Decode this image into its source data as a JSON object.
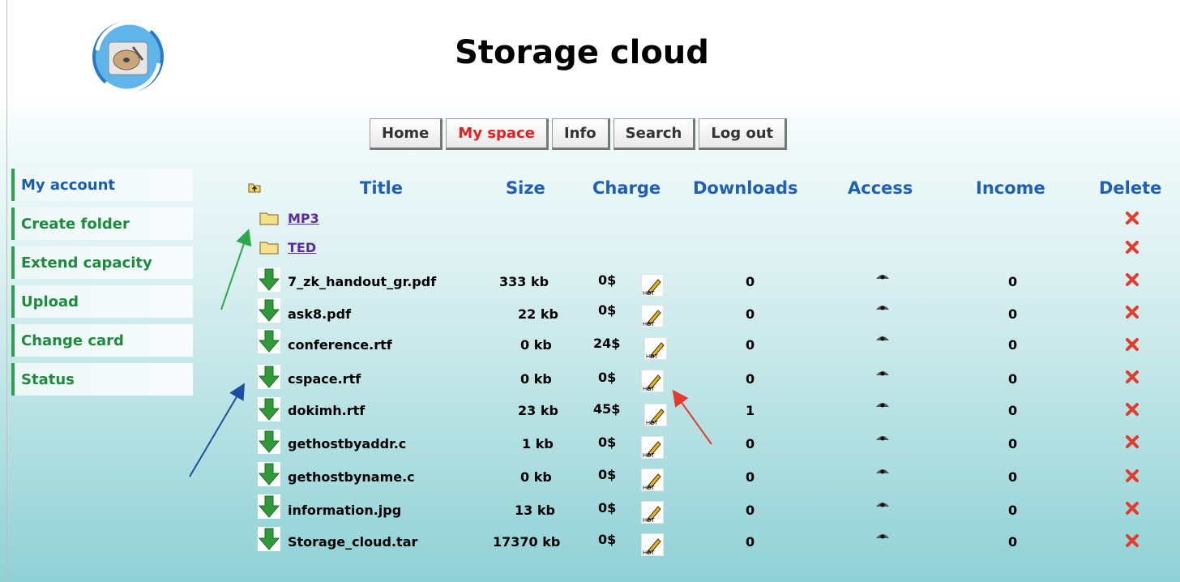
{
  "site": {
    "title": "Storage cloud"
  },
  "tabs": [
    {
      "label": "Home",
      "active": false
    },
    {
      "label": "My space",
      "active": true
    },
    {
      "label": "Info",
      "active": false
    },
    {
      "label": "Search",
      "active": false
    },
    {
      "label": "Log out",
      "active": false
    }
  ],
  "sidebar": {
    "items": [
      {
        "label": "My account"
      },
      {
        "label": "Create folder"
      },
      {
        "label": "Extend capacity"
      },
      {
        "label": "Upload"
      },
      {
        "label": "Change card"
      },
      {
        "label": "Status"
      }
    ]
  },
  "table": {
    "headers": {
      "title": "Title",
      "size": "Size",
      "charge": "Charge",
      "downloads": "Downloads",
      "access": "Access",
      "income": "Income",
      "delete": "Delete"
    },
    "folders": [
      {
        "name": "MP3"
      },
      {
        "name": "TED"
      }
    ],
    "files": [
      {
        "name": "7_zk_handout_gr.pdf",
        "size": "333 kb",
        "charge": "0$",
        "downloads": "0",
        "income": "0"
      },
      {
        "name": "ask8.pdf",
        "size": "22 kb",
        "charge": "0$",
        "downloads": "0",
        "income": "0"
      },
      {
        "name": "conference.rtf",
        "size": "0 kb",
        "charge": "24$",
        "downloads": "0",
        "income": "0"
      },
      {
        "name": "cspace.rtf",
        "size": "0 kb",
        "charge": "0$",
        "downloads": "0",
        "income": "0"
      },
      {
        "name": "dokimh.rtf",
        "size": "23 kb",
        "charge": "45$",
        "downloads": "1",
        "income": "0"
      },
      {
        "name": "gethostbyaddr.c",
        "size": "1 kb",
        "charge": "0$",
        "downloads": "0",
        "income": "0"
      },
      {
        "name": "gethostbyname.c",
        "size": "0 kb",
        "charge": "0$",
        "downloads": "0",
        "income": "0"
      },
      {
        "name": "information.jpg",
        "size": "13 kb",
        "charge": "0$",
        "downloads": "0",
        "income": "0"
      },
      {
        "name": "Storage_cloud.tar",
        "size": "17370 kb",
        "charge": "0$",
        "downloads": "0",
        "income": "0"
      }
    ]
  },
  "icons": {
    "logo": "storage-drive-sync-logo",
    "parent": "folder-up-icon",
    "folder": "folder-icon",
    "download": "download-arrow-icon",
    "edit": "pencil-edit-icon",
    "access": "eye-icon",
    "delete": "delete-x-icon",
    "edit_badge": "HOT"
  },
  "colors": {
    "header_blue": "#1f5fb8",
    "sidebar_green": "#1f8a3e",
    "active_tab_red": "#e02020",
    "delete_red": "#e53b2c",
    "link_purple": "#5a2c9c",
    "arrow_green": "#2aa84a",
    "arrow_blue": "#1b4fa0",
    "arrow_red": "#e23b2e"
  }
}
